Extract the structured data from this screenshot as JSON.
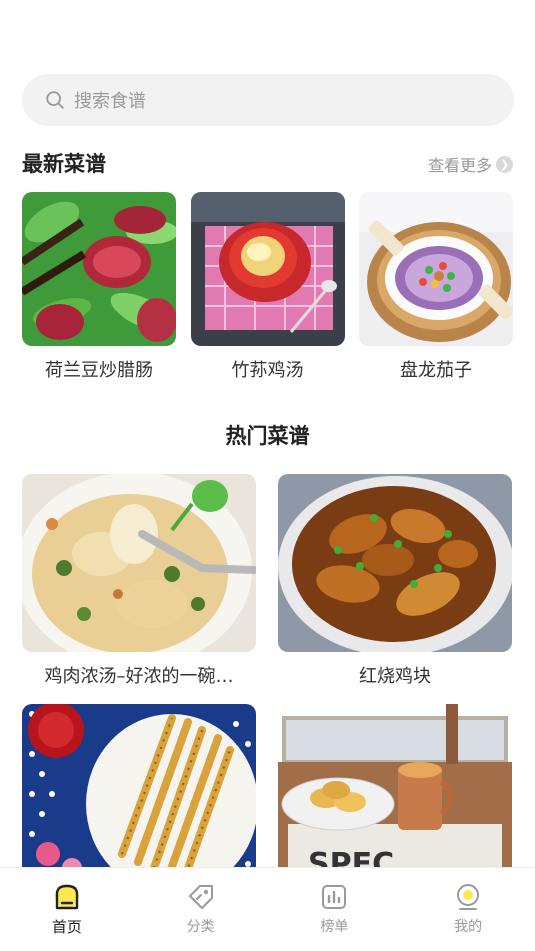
{
  "search": {
    "placeholder": "搜索食谱"
  },
  "latest": {
    "title": "最新菜谱",
    "more_label": "查看更多",
    "items": [
      {
        "name": "荷兰豆炒腊肠"
      },
      {
        "name": "竹荪鸡汤"
      },
      {
        "name": "盘龙茄子"
      }
    ]
  },
  "hot": {
    "title": "热门菜谱",
    "items": [
      {
        "name": "鸡肉浓汤–好浓的一碗…"
      },
      {
        "name": "红烧鸡块"
      },
      {
        "name": ""
      },
      {
        "name": ""
      }
    ]
  },
  "tabbar": {
    "tabs": [
      {
        "label": "首页",
        "icon": "home-icon",
        "active": true
      },
      {
        "label": "分类",
        "icon": "tag-icon",
        "active": false
      },
      {
        "label": "榜单",
        "icon": "chart-icon",
        "active": false
      },
      {
        "label": "我的",
        "icon": "profile-icon",
        "active": false
      }
    ]
  },
  "colors": {
    "accent": "#ffe84d",
    "tab_inactive": "#9a9a9a"
  }
}
